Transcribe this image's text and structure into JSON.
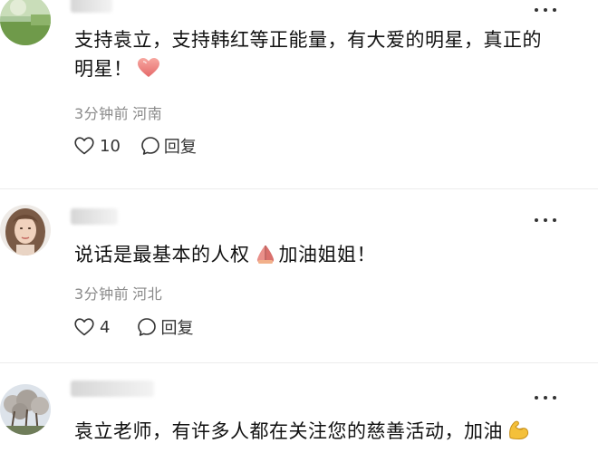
{
  "comments": [
    {
      "text_line1": "支持袁立，支持韩红等正能量，有大爱的明星，真正的",
      "text_line2": "明星！",
      "time": "3分钟前",
      "location": "河南",
      "likes": "10",
      "reply_label": "回复",
      "emoji": "heart-emoji"
    },
    {
      "text": "说话是最基本的人权",
      "text_after_emoji": "加油姐姐！",
      "time": "3分钟前",
      "location": "河北",
      "likes": "4",
      "reply_label": "回复",
      "emoji": "praying-hands-emoji"
    },
    {
      "text": "袁立老师，有许多人都在关注您的慈善活动，加油",
      "emoji": "flexed-biceps-emoji"
    }
  ],
  "colors": {
    "text": "#111111",
    "meta": "#8a8a8a",
    "background": "#ffffff",
    "emoji_heart": "#f08a8a",
    "emoji_biceps": "#f2b630"
  },
  "icons": [
    "more-icon",
    "heart-outline-icon",
    "reply-bubble-icon"
  ]
}
